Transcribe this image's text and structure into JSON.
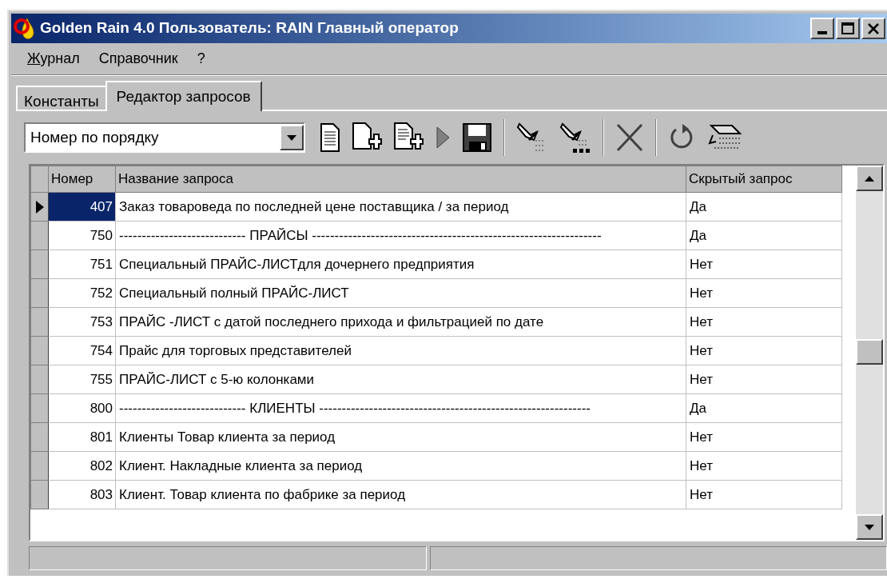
{
  "window": {
    "title": "Golden Rain 4.0 Пользователь: RAIN Главный оператор"
  },
  "menu": [
    {
      "label": "Журнал",
      "underline_first": true
    },
    {
      "label": "Справочник",
      "underline_first": false
    },
    {
      "label": "?",
      "underline_first": false
    }
  ],
  "tabs": [
    {
      "label": "Константы",
      "selected": false
    },
    {
      "label": "Редактор запросов",
      "selected": true
    }
  ],
  "sort_select": {
    "value": "Номер по порядку"
  },
  "table": {
    "columns": [
      "Номер",
      "Название запроса",
      "Скрытый запрос"
    ],
    "rows": [
      {
        "number": "407",
        "name": "Заказ товароведа по последней цене поставщика / за период",
        "hidden": "Да",
        "selected": true
      },
      {
        "number": "750",
        "name": "---------------------------- ПРАЙСЫ ----------------------------------------------------------------",
        "hidden": "Да",
        "selected": false
      },
      {
        "number": "751",
        "name": "Специальный ПРАЙС-ЛИСТдля дочернего предприятия",
        "hidden": "Нет",
        "selected": false
      },
      {
        "number": "752",
        "name": "Специальный полный ПРАЙС-ЛИСТ",
        "hidden": "Нет",
        "selected": false
      },
      {
        "number": "753",
        "name": "ПРАЙС -ЛИСТ с датой последнего прихода и фильтрацией по дате",
        "hidden": "Нет",
        "selected": false
      },
      {
        "number": "754",
        "name": "Прайс для торговых представителей",
        "hidden": "Нет",
        "selected": false
      },
      {
        "number": "755",
        "name": "ПРАЙС-ЛИСТ с 5-ю колонками",
        "hidden": "Нет",
        "selected": false
      },
      {
        "number": "800",
        "name": "---------------------------- КЛИЕНТЫ ------------------------------------------------------------",
        "hidden": "Да",
        "selected": false
      },
      {
        "number": "801",
        "name": "Клиенты Товар клиента за период",
        "hidden": "Нет",
        "selected": false
      },
      {
        "number": "802",
        "name": "Клиент. Накладные клиента за период",
        "hidden": "Нет",
        "selected": false
      },
      {
        "number": "803",
        "name": "Клиент. Товар клиента по фабрике за период",
        "hidden": "Нет",
        "selected": false
      }
    ]
  }
}
